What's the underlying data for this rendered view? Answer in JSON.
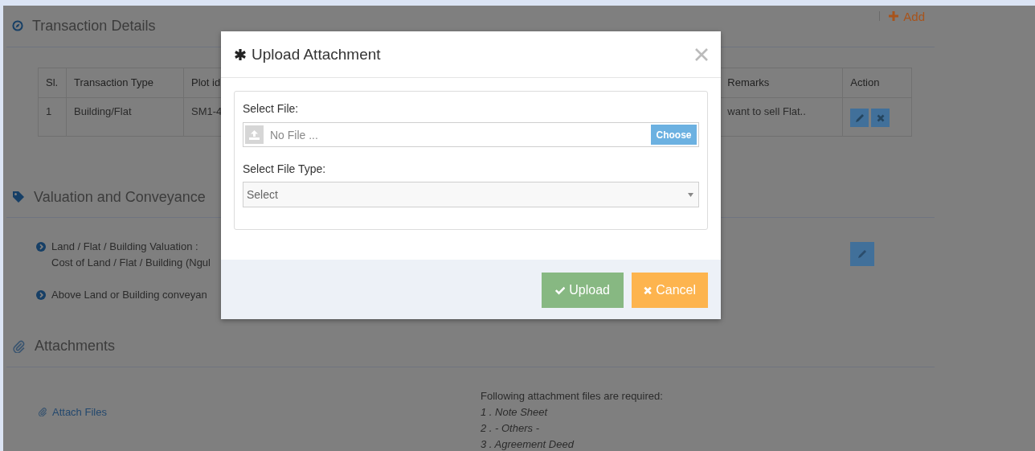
{
  "transaction": {
    "title": "Transaction Details",
    "add_link": "Add",
    "table": {
      "columns": [
        "Sl.",
        "Transaction Type",
        "Plot id",
        "Remarks",
        "Action"
      ],
      "rows": [
        {
          "cells": [
            "1",
            "Building/Flat",
            "SM1-4",
            "want to sell Flat.."
          ]
        }
      ]
    }
  },
  "valuation": {
    "title": "Valuation and Conveyance",
    "items": [
      {
        "lines": [
          "Land / Flat / Building Valuation :",
          "Cost of Land / Flat / Building (Ngul"
        ]
      },
      {
        "lines": [
          "Above Land or Building conveyan"
        ]
      }
    ]
  },
  "attachments": {
    "title": "Attachments",
    "attach_link": "Attach Files",
    "required_heading": "Following attachment files are required:",
    "required_files": [
      "1 . Note Sheet",
      "2 . - Others -",
      "3 . Agreement Deed"
    ]
  },
  "modal": {
    "title": "Upload Attachment",
    "file_label": "Select File:",
    "file_placeholder": "No File ...",
    "choose_button": "Choose",
    "type_label": "Select File Type:",
    "type_value": "Select",
    "buttons": [
      {
        "label": "Upload",
        "kind": "upload"
      },
      {
        "label": "Cancel",
        "kind": "cancel"
      }
    ]
  }
}
